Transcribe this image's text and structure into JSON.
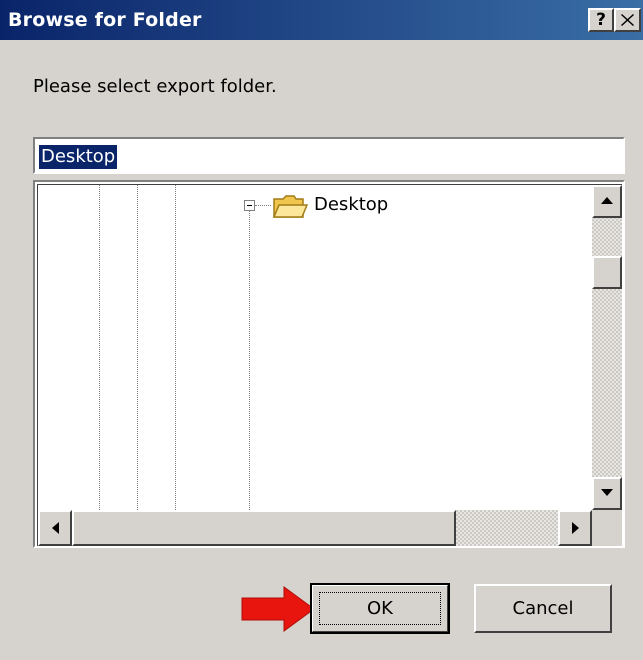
{
  "window": {
    "title": "Browse for Folder",
    "help_label": "?",
    "close_label": "X"
  },
  "prompt": "Please select export folder.",
  "path_field": {
    "value": "Desktop"
  },
  "tree": {
    "nodes": [
      {
        "label": "Desktop",
        "icon": "folder-icon",
        "expanded": true
      }
    ]
  },
  "buttons": {
    "ok_label": "OK",
    "cancel_label": "Cancel"
  },
  "annotation": {
    "icon": "red-arrow-icon",
    "color": "#e8150f"
  },
  "colors": {
    "titlebar_start": "#0a246a",
    "titlebar_end": "#3a6ea5",
    "dialog_face": "#d6d3ce",
    "selection": "#0a246a"
  }
}
